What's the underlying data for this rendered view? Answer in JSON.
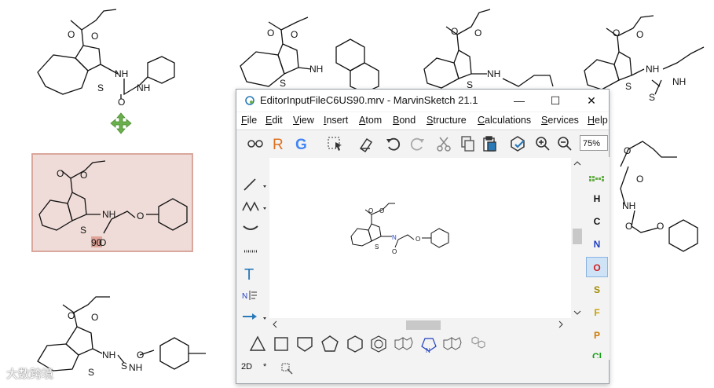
{
  "window": {
    "title": "EditorInputFileC6US90.mrv - MarvinSketch 21.1",
    "minimize": "—",
    "maximize": "☐",
    "close": "✕"
  },
  "menu": [
    "File",
    "Edit",
    "View",
    "Insert",
    "Atom",
    "Bond",
    "Structure",
    "Calculations",
    "Services",
    "Help"
  ],
  "menu_underline": [
    "F",
    "E",
    "V",
    "I",
    "A",
    "B",
    "S",
    "C",
    "S",
    "H"
  ],
  "toolbar": {
    "zoom": "75%"
  },
  "atoms": [
    {
      "symbol": "H",
      "color": "#111111"
    },
    {
      "symbol": "C",
      "color": "#111111"
    },
    {
      "symbol": "N",
      "color": "#1f3fbf"
    },
    {
      "symbol": "O",
      "color": "#d12020"
    },
    {
      "symbol": "S",
      "color": "#a08a00"
    },
    {
      "symbol": "F",
      "color": "#c8a000"
    },
    {
      "symbol": "P",
      "color": "#cc7a00"
    },
    {
      "symbol": "Cl",
      "color": "#1aa01a"
    }
  ],
  "bottom": {
    "dim": "2D",
    "star": "*"
  },
  "labels": {
    "NH": "NH",
    "H": "H",
    "N": "N",
    "O": "O",
    "S": "S",
    "N_small": "N",
    "O90": "90",
    "O_small": "O"
  },
  "watermark": "大数跨境"
}
